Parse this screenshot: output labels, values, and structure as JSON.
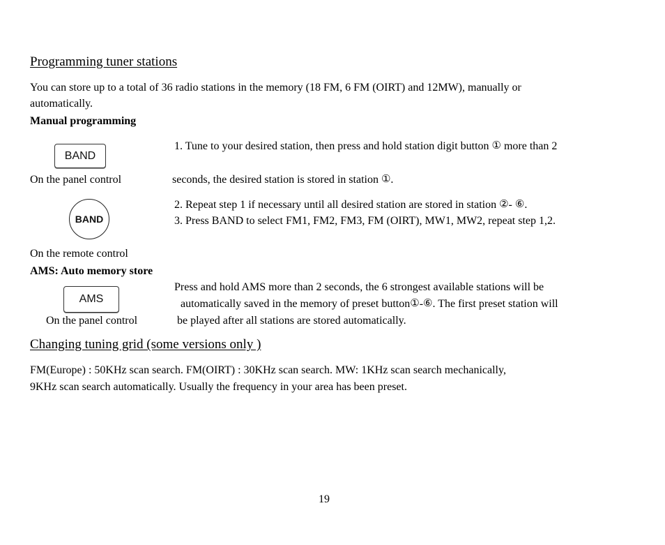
{
  "section1": {
    "title": "Programming tuner stations",
    "intro_line1": "You can store up to a total of 36 radio stations in the memory (18 FM, 6 FM (OIRT) and 12MW), manually or",
    "intro_line2": "automatically.",
    "manual_heading": "Manual programming",
    "band_panel_button": "BAND",
    "panel_caption": "On the panel control",
    "band_remote_button": "BAND",
    "remote_caption": "On the remote control",
    "step1_a": "1. Tune to your desired station, then press and hold station digit button",
    "step1_circ": "①",
    "step1_b": "more than 2",
    "step1_c": "seconds, the desired station is stored in station",
    "step1_c_circ": "①",
    "step1_c_end": ".",
    "step2_a": "2. Repeat step 1 if necessary until all desired station are stored in station",
    "step2_circ_from": "②",
    "step2_dash": "-",
    "step2_circ_to": "⑥",
    "step2_end": ".",
    "step3": "3. Press BAND to select FM1, FM2, FM3, FM (OIRT), MW1, MW2, repeat step 1,2.",
    "ams_heading": "AMS: Auto memory store",
    "ams_button": "AMS",
    "ams_caption": "On the panel control",
    "ams_line1": "Press and hold AMS more than 2 seconds, the 6 strongest available stations will be",
    "ams_line2_a": "automatically saved in the memory of preset button",
    "ams_circ_from": "①",
    "ams_dash": "-",
    "ams_circ_to": "⑥",
    "ams_line2_b": ". The first preset station will",
    "ams_line3": "be played after all stations are stored automatically."
  },
  "section2": {
    "title": "Changing tuning grid (some versions only )",
    "line1": "FM(Europe) : 50KHz scan search. FM(OIRT) : 30KHz scan search. MW: 1KHz scan search mechanically,",
    "line2": "9KHz scan search automatically. Usually the frequency in your area has been preset."
  },
  "page_number": "19"
}
